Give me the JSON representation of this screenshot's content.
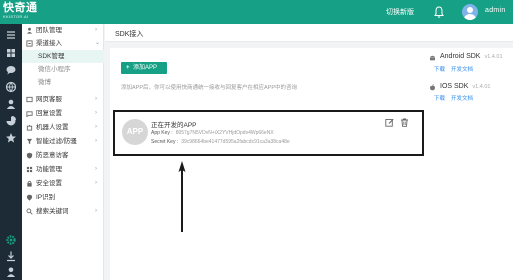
{
  "header": {
    "logo_text": "快奇通",
    "logo_sub": "KKISTOR.AI",
    "switch_label": "切换新版",
    "username": "admin",
    "bar_color": "#16a085"
  },
  "rail": {
    "icons": [
      "menu-icon",
      "grid-icon",
      "chat-icon",
      "globe-icon",
      "user-icon",
      "chart-icon",
      "star-icon",
      "settings-icon",
      "person-icon"
    ]
  },
  "menu": {
    "items": [
      {
        "label": "团队管理",
        "icon": "team-icon",
        "arrow": "›"
      },
      {
        "label": "渠道接入",
        "icon": "channel-icon",
        "arrow": "⌄"
      },
      {
        "label": "SDK管理",
        "sub": true,
        "active": true
      },
      {
        "label": "微信小程序",
        "sub": true
      },
      {
        "label": "微博",
        "sub": true
      },
      {
        "label": "网页客服",
        "icon": "web-icon",
        "arrow": "›"
      },
      {
        "label": "回复设置",
        "icon": "reply-icon",
        "arrow": "›"
      },
      {
        "label": "机器人设置",
        "icon": "robot-icon",
        "arrow": "›"
      },
      {
        "label": "智能过滤/防骚",
        "icon": "filter-icon",
        "arrow": "›"
      },
      {
        "label": "防恶意访客",
        "icon": "shield-icon",
        "arrow": ""
      },
      {
        "label": "功能管理",
        "icon": "func-icon",
        "arrow": "›"
      },
      {
        "label": "安全设置",
        "icon": "lock-icon",
        "arrow": "›"
      },
      {
        "label": "IP识别",
        "icon": "ip-icon",
        "arrow": ""
      },
      {
        "label": "搜索关键词",
        "icon": "search-icon",
        "arrow": "›"
      }
    ]
  },
  "breadcrumb": "SDK接入",
  "main": {
    "add_button": "添加APP",
    "hint": "添加APP后，你可以使用快商通统一接收与回复客户在相应APP中的咨询",
    "app": {
      "avatar_text": "APP",
      "name": "正在开发的APP",
      "key_label": "App Key :",
      "key_value": "8057g7N5VDvN+iX2YVHjdOpdv4Wp66eNX",
      "secret_label": "Secret Key :",
      "secret_value": "39c98664be41477d595a2fabcdc91ca3a38ca48e"
    }
  },
  "sdks": [
    {
      "name": "Android SDK",
      "version": "v1.4.01",
      "download": "下载",
      "docs": "开发文档",
      "icon": "android-icon"
    },
    {
      "name": "IOS SDK",
      "version": "v1.4.01",
      "download": "下载",
      "docs": "开发文档",
      "icon": "apple-icon"
    }
  ]
}
